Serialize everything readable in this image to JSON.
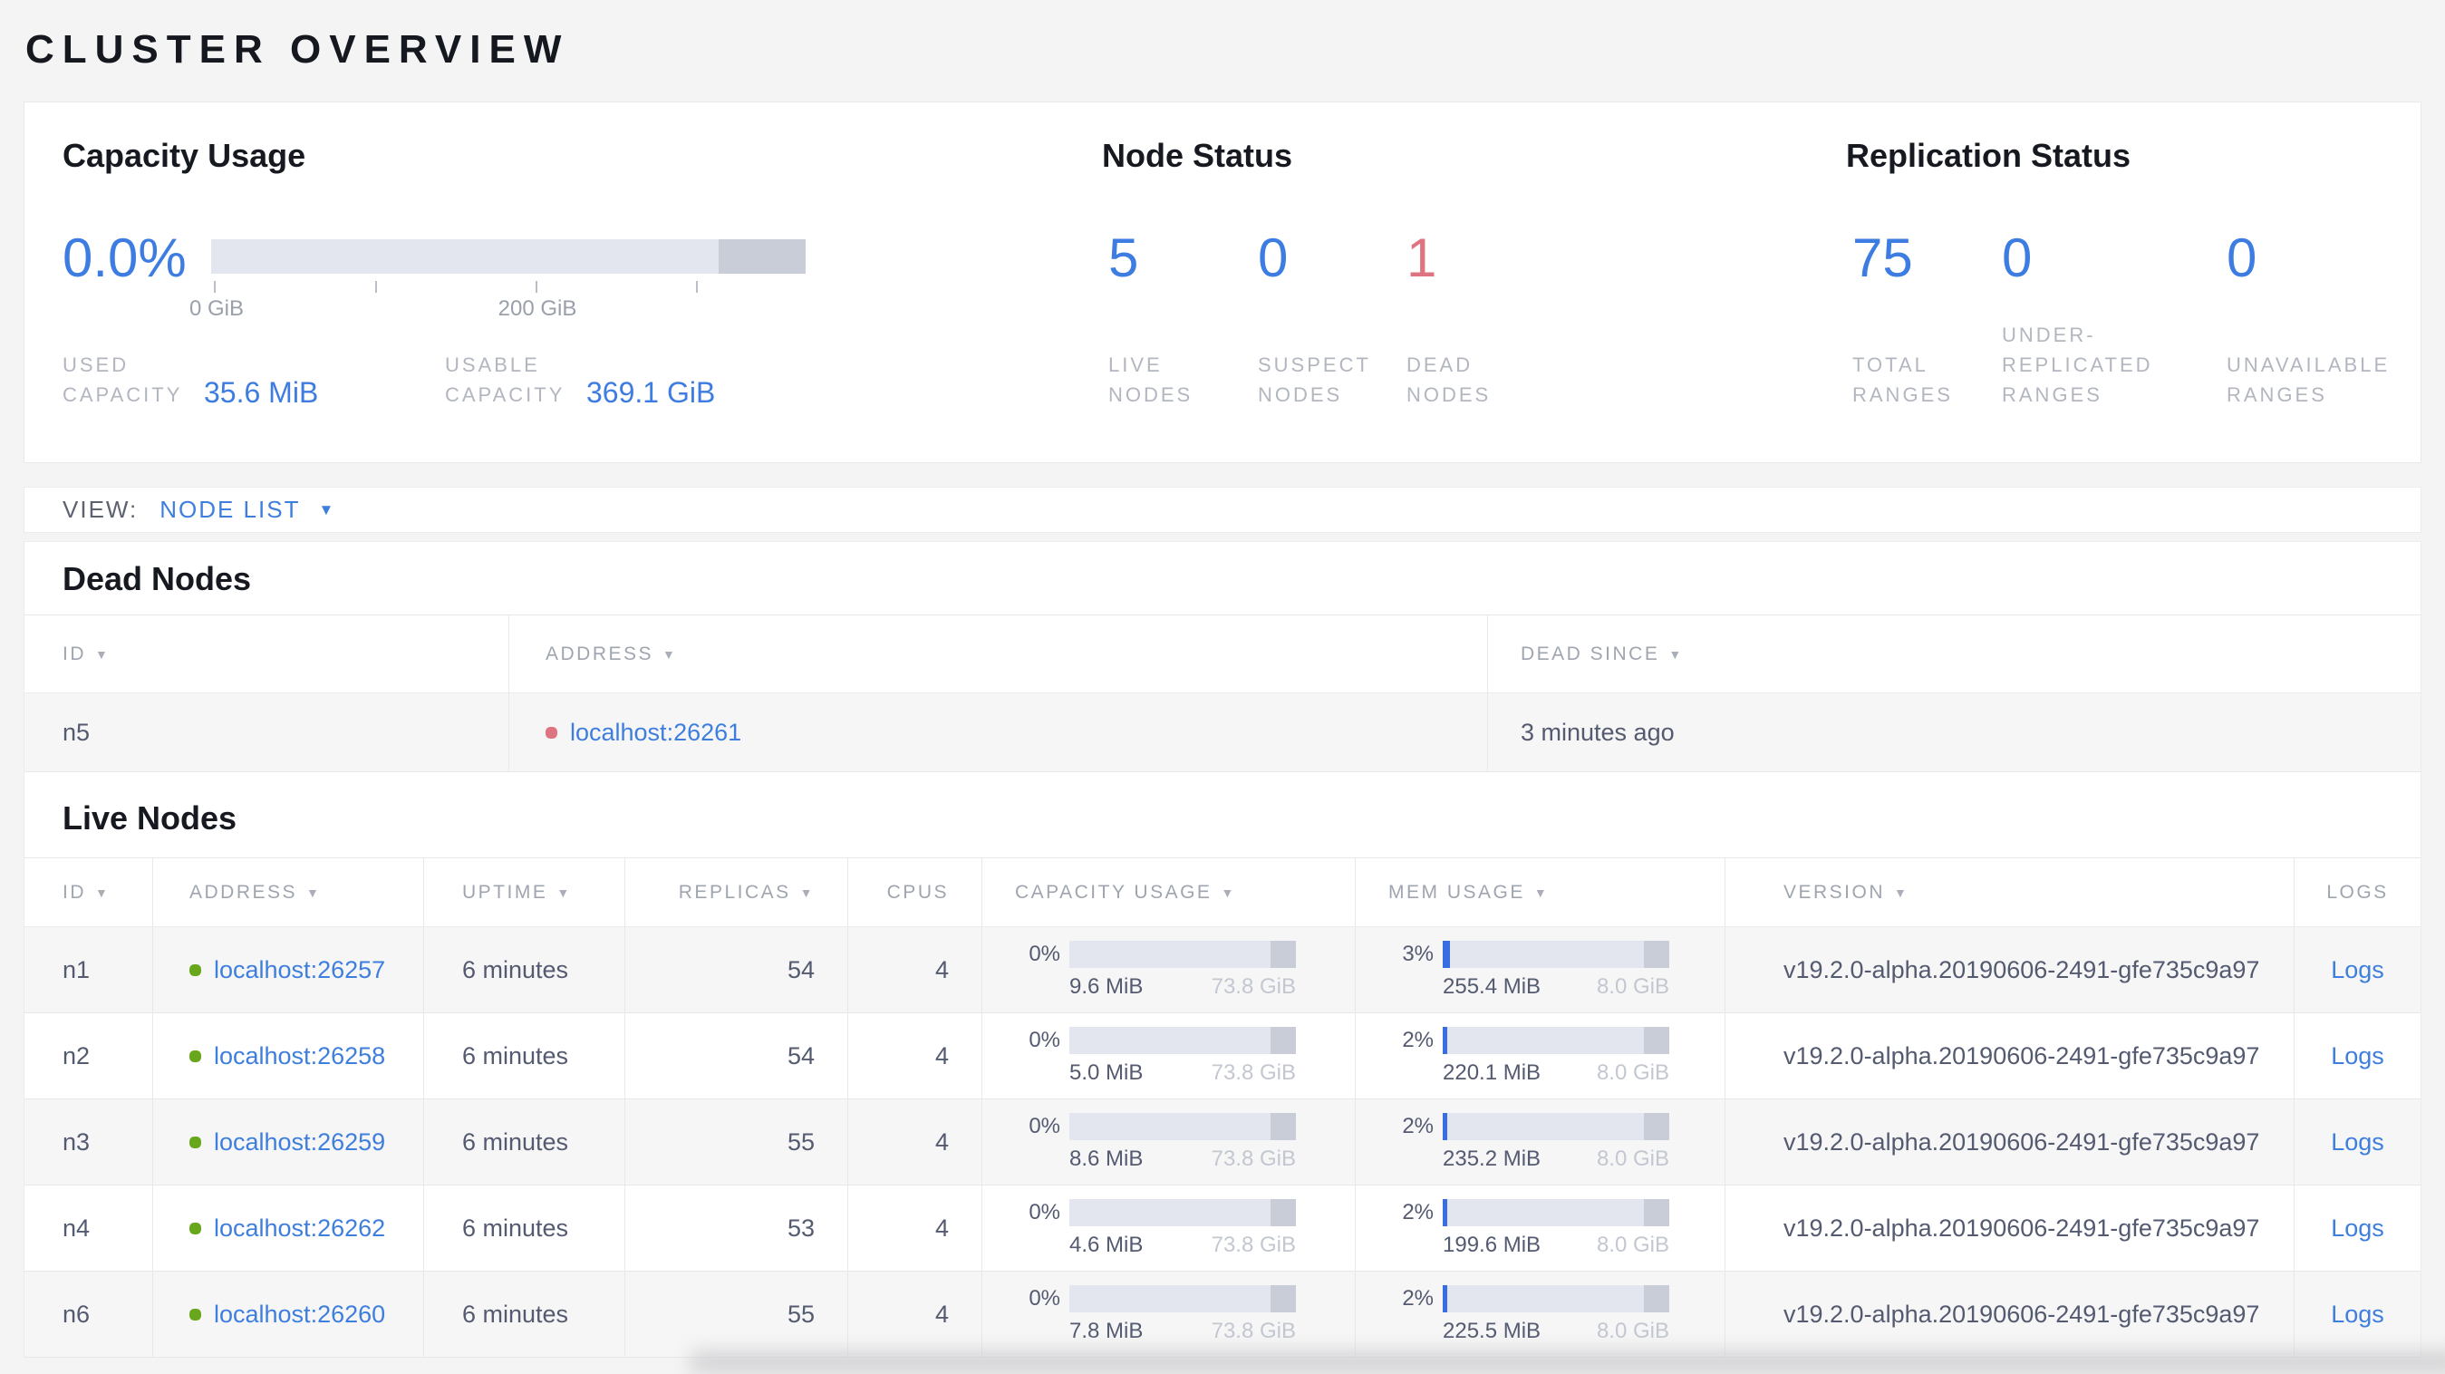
{
  "page_title": "CLUSTER OVERVIEW",
  "summary": {
    "capacity": {
      "title": "Capacity Usage",
      "percent": "0.0%",
      "tick_labels": [
        "0 GiB",
        "200 GiB"
      ],
      "stats": [
        {
          "label": "USED CAPACITY",
          "value": "35.6 MiB"
        },
        {
          "label": "USABLE CAPACITY",
          "value": "369.1 GiB"
        }
      ]
    },
    "node_status": {
      "title": "Node Status",
      "stats": [
        {
          "value": "5",
          "label": "LIVE NODES",
          "status": "live"
        },
        {
          "value": "0",
          "label": "SUSPECT NODES",
          "status": "suspect"
        },
        {
          "value": "1",
          "label": "DEAD NODES",
          "status": "dead"
        }
      ]
    },
    "replication": {
      "title": "Replication Status",
      "stats": [
        {
          "value": "75",
          "label": "TOTAL RANGES"
        },
        {
          "value": "0",
          "label": "UNDER-REPLICATED RANGES"
        },
        {
          "value": "0",
          "label": "UNAVAILABLE RANGES"
        }
      ]
    }
  },
  "view_bar": {
    "label": "VIEW:",
    "selected": "NODE LIST"
  },
  "dead_nodes": {
    "title": "Dead Nodes",
    "columns": [
      {
        "label": "ID",
        "sortable": true
      },
      {
        "label": "ADDRESS",
        "sortable": true
      },
      {
        "label": "DEAD SINCE",
        "sortable": true
      }
    ],
    "rows": [
      {
        "id": "n5",
        "address": "localhost:26261",
        "dead_since": "3 minutes ago"
      }
    ]
  },
  "live_nodes": {
    "title": "Live Nodes",
    "columns": [
      {
        "label": "ID",
        "sortable": true
      },
      {
        "label": "ADDRESS",
        "sortable": true
      },
      {
        "label": "UPTIME",
        "sortable": true
      },
      {
        "label": "REPLICAS",
        "sortable": true
      },
      {
        "label": "CPUS",
        "sortable": false
      },
      {
        "label": "CAPACITY USAGE",
        "sortable": true
      },
      {
        "label": "MEM USAGE",
        "sortable": true
      },
      {
        "label": "VERSION",
        "sortable": true
      },
      {
        "label": "LOGS",
        "sortable": false
      }
    ],
    "logs_label": "Logs",
    "rows": [
      {
        "id": "n1",
        "address": "localhost:26257",
        "uptime": "6 minutes",
        "replicas": "54",
        "cpus": "4",
        "capacity": {
          "percent": "0%",
          "fill": 0,
          "used": "9.6 MiB",
          "total": "73.8 GiB"
        },
        "mem": {
          "percent": "3%",
          "fill": 3,
          "used": "255.4 MiB",
          "total": "8.0 GiB"
        },
        "version": "v19.2.0-alpha.20190606-2491-gfe735c9a97"
      },
      {
        "id": "n2",
        "address": "localhost:26258",
        "uptime": "6 minutes",
        "replicas": "54",
        "cpus": "4",
        "capacity": {
          "percent": "0%",
          "fill": 0,
          "used": "5.0 MiB",
          "total": "73.8 GiB"
        },
        "mem": {
          "percent": "2%",
          "fill": 2,
          "used": "220.1 MiB",
          "total": "8.0 GiB"
        },
        "version": "v19.2.0-alpha.20190606-2491-gfe735c9a97"
      },
      {
        "id": "n3",
        "address": "localhost:26259",
        "uptime": "6 minutes",
        "replicas": "55",
        "cpus": "4",
        "capacity": {
          "percent": "0%",
          "fill": 0,
          "used": "8.6 MiB",
          "total": "73.8 GiB"
        },
        "mem": {
          "percent": "2%",
          "fill": 2,
          "used": "235.2 MiB",
          "total": "8.0 GiB"
        },
        "version": "v19.2.0-alpha.20190606-2491-gfe735c9a97"
      },
      {
        "id": "n4",
        "address": "localhost:26262",
        "uptime": "6 minutes",
        "replicas": "53",
        "cpus": "4",
        "capacity": {
          "percent": "0%",
          "fill": 0,
          "used": "4.6 MiB",
          "total": "73.8 GiB"
        },
        "mem": {
          "percent": "2%",
          "fill": 2,
          "used": "199.6 MiB",
          "total": "8.0 GiB"
        },
        "version": "v19.2.0-alpha.20190606-2491-gfe735c9a97"
      },
      {
        "id": "n6",
        "address": "localhost:26260",
        "uptime": "6 minutes",
        "replicas": "55",
        "cpus": "4",
        "capacity": {
          "percent": "0%",
          "fill": 0,
          "used": "7.8 MiB",
          "total": "73.8 GiB"
        },
        "mem": {
          "percent": "2%",
          "fill": 2,
          "used": "225.5 MiB",
          "total": "8.0 GiB"
        },
        "version": "v19.2.0-alpha.20190606-2491-gfe735c9a97"
      }
    ]
  },
  "colors": {
    "accent_blue": "#3d7ce1",
    "link_blue": "#3e7edd",
    "dead_red": "#de7480",
    "live_green": "#68a71c",
    "bar_track": "#e3e6ee",
    "bar_reserved": "#c9cdd8",
    "bar_fill": "#3a6de0"
  }
}
